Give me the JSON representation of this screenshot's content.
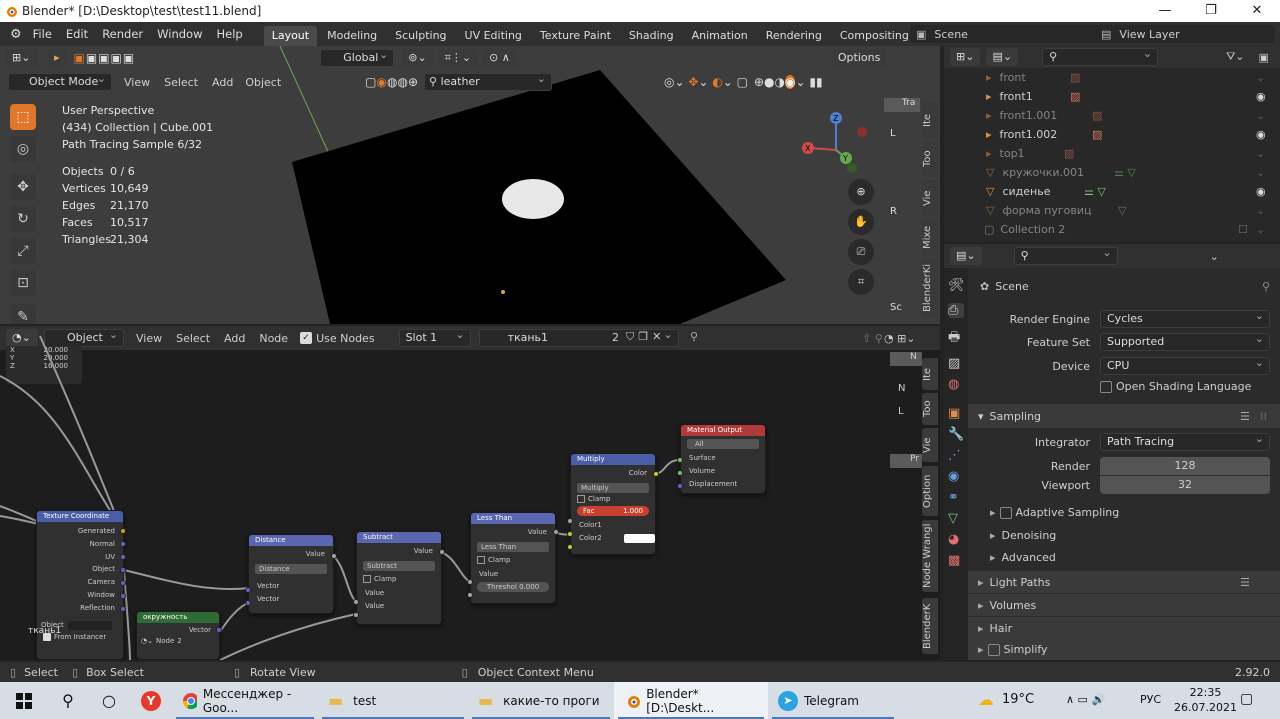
{
  "window": {
    "title": "Blender* [D:\\Desktop\\test\\test11.blend]",
    "min": "—",
    "max": "❐",
    "close": "✕"
  },
  "menu": [
    "File",
    "Edit",
    "Render",
    "Window",
    "Help"
  ],
  "workspace_tabs": [
    "Layout",
    "Modeling",
    "Sculpting",
    "UV Editing",
    "Texture Paint",
    "Shading",
    "Animation",
    "Rendering",
    "Compositing",
    "Scripting"
  ],
  "workspace_add": "+",
  "scene": {
    "label": "Scene",
    "view_layer": "View Layer"
  },
  "viewport": {
    "orientation": "Global",
    "options": "Options",
    "mode": "Object Mode",
    "menus": [
      "View",
      "Select",
      "Add",
      "Object"
    ],
    "search": "leather",
    "info": [
      "User Perspective",
      "(434) Collection | Cube.001",
      "Path Tracing Sample 6/32"
    ],
    "stats": [
      {
        "k": "Objects",
        "v": "0 / 6"
      },
      {
        "k": "Vertices",
        "v": "10,649"
      },
      {
        "k": "Edges",
        "v": "21,170"
      },
      {
        "k": "Faces",
        "v": "10,517"
      },
      {
        "k": "Triangles",
        "v": "21,304"
      }
    ],
    "axes": {
      "x": "X",
      "y": "Y",
      "z": "Z"
    },
    "side_tabs": [
      "Ite",
      "Too",
      "Vie",
      "Mixe",
      "BlenderKi"
    ],
    "side_labels": {
      "tra": "Tra",
      "l": "L",
      "r": "R",
      "sc": "Sc"
    }
  },
  "node_editor": {
    "type": "Object",
    "menus": [
      "View",
      "Select",
      "Add",
      "Node"
    ],
    "use_nodes": "Use Nodes",
    "slot": "Slot 1",
    "material": "ткань1",
    "users": "2",
    "side_tabs": [
      "Ite",
      "Too",
      "Vie",
      "Option",
      "Node Wrangl",
      "BlenderK"
    ],
    "side_labels": {
      "n": "N",
      "pr": "Pr",
      "n2": "N",
      "l": "L"
    },
    "loc": [
      {
        "k": "X",
        "v": "20.000"
      },
      {
        "k": "Y",
        "v": "20.000"
      },
      {
        "k": "Z",
        "v": "16.000"
      }
    ],
    "nodes": {
      "tex_coord": {
        "title": "Texture Coordinate",
        "outputs": [
          "Generated",
          "Normal",
          "UV",
          "Object",
          "Camera",
          "Window",
          "Reflection"
        ],
        "object_label": "Object",
        "from_instancer": "From Instancer"
      },
      "distance": {
        "title": "Distance",
        "out": "Value",
        "mode": "Distance",
        "in1": "Vector",
        "in2": "Vector"
      },
      "subtract": {
        "title": "Subtract",
        "out": "Value",
        "mode": "Subtract",
        "clamp": "Clamp",
        "in1": "Value",
        "in2": "Value"
      },
      "less_than": {
        "title": "Less Than",
        "out": "Value",
        "mode": "Less Than",
        "clamp": "Clamp",
        "in1": "Value",
        "thresh": "Threshol 0.000"
      },
      "multiply": {
        "title": "Multiply",
        "out": "Color",
        "mode": "Multiply",
        "clamp": "Clamp",
        "fac": "Fac",
        "fac_val": "1.000",
        "c1": "Color1",
        "c2": "Color2"
      },
      "output": {
        "title": "Material Output",
        "target": "All",
        "in1": "Surface",
        "in2": "Volume",
        "in3": "Displacement"
      },
      "circle": {
        "title": "окружность",
        "out": "Vector",
        "node": "Node",
        "users": "2"
      },
      "frame_label": "ткань1"
    }
  },
  "outliner": {
    "items": [
      {
        "name": "front",
        "dim": true,
        "eye": false
      },
      {
        "name": "front1",
        "dim": false,
        "eye": true
      },
      {
        "name": "front1.001",
        "dim": true,
        "eye": false
      },
      {
        "name": "front1.002",
        "dim": false,
        "eye": true
      },
      {
        "name": "top1",
        "dim": true,
        "eye": false
      },
      {
        "name": "кружочки.001",
        "dim": true,
        "eye": false
      },
      {
        "name": "сиденье",
        "dim": false,
        "eye": true
      },
      {
        "name": "форма пуговиц",
        "dim": true,
        "eye": false
      },
      {
        "name": "Collection 2",
        "dim": true,
        "eye": false
      }
    ]
  },
  "properties": {
    "context": "Scene",
    "rows": [
      {
        "label": "Render Engine",
        "value": "Cycles"
      },
      {
        "label": "Feature Set",
        "value": "Supported"
      },
      {
        "label": "Device",
        "value": "CPU"
      }
    ],
    "osl": "Open Shading Language",
    "sampling": "Sampling",
    "integrator_label": "Integrator",
    "integrator": "Path Tracing",
    "render_label": "Render",
    "render": "128",
    "viewport_label": "Viewport",
    "viewport": "32",
    "subpanels": [
      "Adaptive Sampling",
      "Denoising",
      "Advanced"
    ],
    "panels": [
      "Light Paths",
      "Volumes",
      "Hair",
      "Simplify"
    ]
  },
  "statusbar": {
    "select": "Select",
    "box": "Box Select",
    "rotate": "Rotate View",
    "context": "Object Context Menu",
    "version": "2.92.0"
  },
  "taskbar": {
    "items": [
      "Мессенджер - Goo...",
      "test",
      "какие-то проги",
      "Blender* [D:\\Deskt...",
      "Telegram"
    ],
    "temp": "19°C",
    "lang": "РУС",
    "time": "22:35",
    "date": "26.07.2021"
  },
  "colors": {
    "accent": "#e0772a",
    "tex_header": "#4a5ea8",
    "vector_header": "#5a66b0",
    "color_header": "#4a5ea8",
    "output_header": "#b0393a",
    "shader_header": "#2f6b34"
  }
}
